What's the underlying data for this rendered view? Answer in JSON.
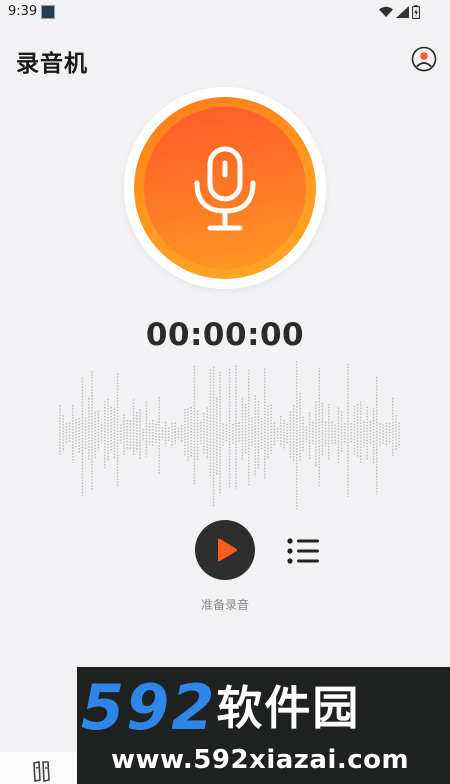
{
  "status_bar": {
    "time": "9:39",
    "icons": [
      "wifi-icon",
      "signal-icon",
      "battery-icon"
    ]
  },
  "header": {
    "title": "录音机",
    "profile_icon": "person-icon"
  },
  "recorder": {
    "mic_icon": "microphone-icon",
    "timer": "00:00:00",
    "status": "准备录音",
    "colors": {
      "accent": "#ff6a22",
      "ring": "#ffa726",
      "play_bg": "#2d2d2d"
    }
  },
  "controls": {
    "play_icon": "play-icon",
    "list_icon": "list-icon"
  },
  "bottom_nav": {
    "icon": "recordings-icon"
  },
  "watermark": {
    "digits": "592",
    "brand": "软件园",
    "url": "www.592xiazai.com"
  }
}
